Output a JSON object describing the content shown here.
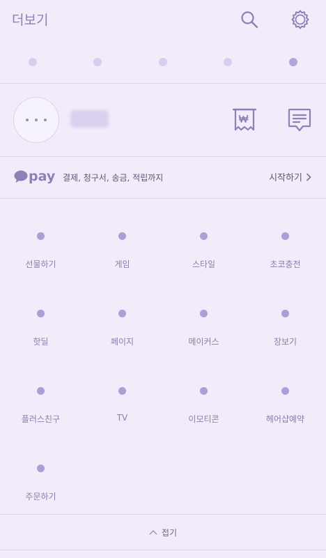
{
  "header": {
    "title": "더보기",
    "search_icon": "search-icon",
    "settings_icon": "gear-icon"
  },
  "quick_dots": [
    {
      "name": "quick-slot-1",
      "color": "#D7CCED"
    },
    {
      "name": "quick-slot-2",
      "color": "#D7CCED"
    },
    {
      "name": "quick-slot-3",
      "color": "#D7CCED"
    },
    {
      "name": "quick-slot-4",
      "color": "#D7CCED"
    },
    {
      "name": "quick-slot-5",
      "color": "#B6A3DC"
    }
  ],
  "profile": {
    "avatar_icon": "ellipsis-icon",
    "receipt_icon": "receipt-won-icon",
    "chat_icon": "message-icon"
  },
  "pay": {
    "logo": "pay",
    "description": "결제, 청구서, 송금, 적립까지",
    "action_label": "시작하기"
  },
  "services": [
    {
      "label": "선물하기"
    },
    {
      "label": "게임"
    },
    {
      "label": "스타일"
    },
    {
      "label": "초코충전"
    },
    {
      "label": "핫딜"
    },
    {
      "label": "페이지"
    },
    {
      "label": "메이커스"
    },
    {
      "label": "장보기"
    },
    {
      "label": "플러스친구"
    },
    {
      "label": "TV"
    },
    {
      "label": "이모티콘"
    },
    {
      "label": "헤어샵예약"
    },
    {
      "label": "주문하기"
    }
  ],
  "fold": {
    "label": "접기"
  },
  "colors": {
    "background": "#F1EBFA",
    "accent": "#8E7FB6",
    "service_dot": "#B09CD6"
  }
}
